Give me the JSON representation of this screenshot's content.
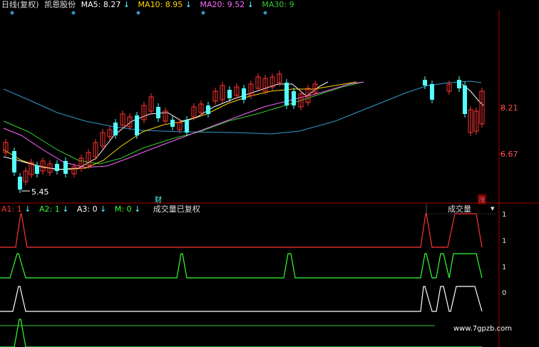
{
  "header": {
    "period": "日线(复权)",
    "stock": "凯恩股份",
    "ma": [
      {
        "label": "MA5:",
        "value": "8.27",
        "color": "#ffffff"
      },
      {
        "label": "MA10:",
        "value": "8.95",
        "color": "#ffd700"
      },
      {
        "label": "MA20:",
        "value": "9.52",
        "color": "#ff66ff"
      },
      {
        "label": "MA30:",
        "value": "9",
        "color": "#33cc33"
      }
    ],
    "down_arrow": "↓"
  },
  "price_axis": [
    "8.21",
    "6.67"
  ],
  "low_label": "5.45",
  "tags": {
    "cai": "财",
    "zhang": "涨"
  },
  "indicator": {
    "items": [
      {
        "label": "A1:",
        "value": "1",
        "color": "#ff3333"
      },
      {
        "label": "A2:",
        "value": "1",
        "color": "#33ff33"
      },
      {
        "label": "A3:",
        "value": "0",
        "color": "#ffffff"
      },
      {
        "label": "M:",
        "value": "0",
        "color": "#33ff33"
      }
    ],
    "note": "成交量已复权",
    "arrow": "↓"
  },
  "volume_button": {
    "label": "成交量",
    "arrow": "▾"
  },
  "indicator_levels": [
    "1",
    "1",
    "1",
    "0"
  ],
  "watermark": "www.7gpzb.com",
  "colors": {
    "up": "#ff3333",
    "down": "#54ffff",
    "ma5": "#ffffff",
    "ma10": "#ffd700",
    "ma20": "#ff66ff",
    "ma30": "#33cc33",
    "ma60": "#3399cc",
    "axis": "#aa0000"
  }
}
